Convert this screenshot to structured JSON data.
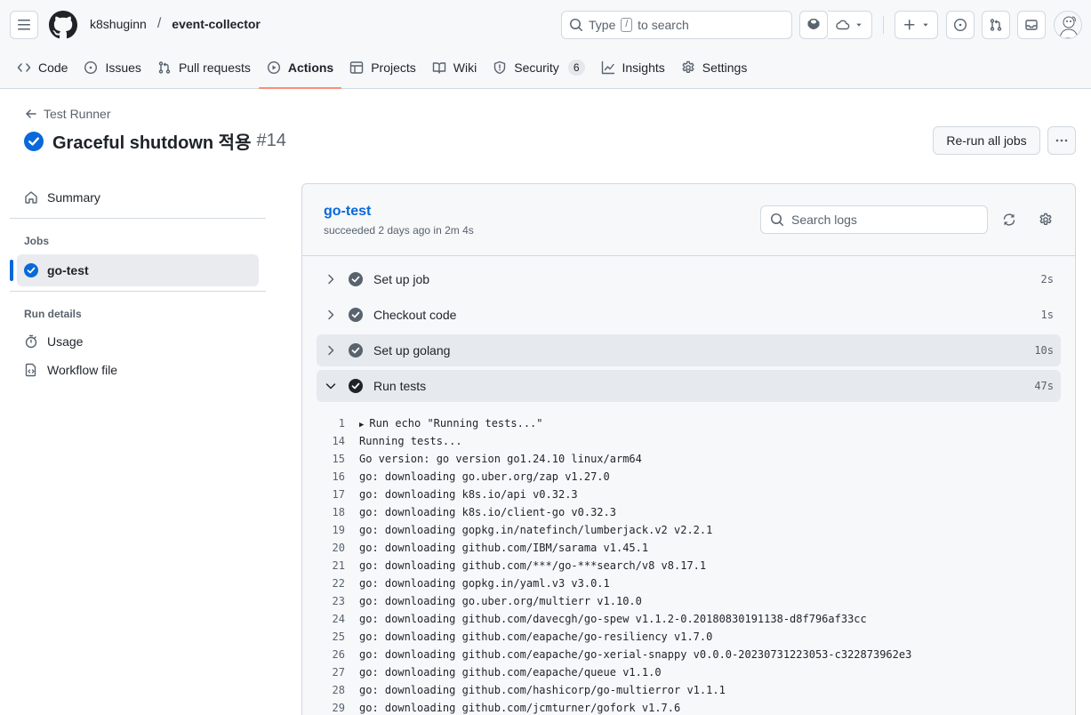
{
  "header": {
    "owner": "k8shuginn",
    "separator": "/",
    "repo": "event-collector",
    "search_prefix": "Type",
    "search_key": "/",
    "search_suffix": "to search"
  },
  "nav": [
    {
      "label": "Code",
      "icon": "code-icon"
    },
    {
      "label": "Issues",
      "icon": "issue-icon"
    },
    {
      "label": "Pull requests",
      "icon": "pull-request-icon"
    },
    {
      "label": "Actions",
      "icon": "play-icon",
      "active": true
    },
    {
      "label": "Projects",
      "icon": "table-icon"
    },
    {
      "label": "Wiki",
      "icon": "book-icon"
    },
    {
      "label": "Security",
      "icon": "shield-icon",
      "counter": "6"
    },
    {
      "label": "Insights",
      "icon": "graph-icon"
    },
    {
      "label": "Settings",
      "icon": "gear-icon"
    }
  ],
  "run": {
    "back_label": "Test Runner",
    "title": "Graceful shutdown 적용",
    "number": "#14",
    "rerun_label": "Re-run all jobs"
  },
  "sidebar": {
    "summary_label": "Summary",
    "jobs_heading": "Jobs",
    "job_label": "go-test",
    "details_heading": "Run details",
    "usage_label": "Usage",
    "workflow_label": "Workflow file"
  },
  "job": {
    "name": "go-test",
    "status": "succeeded 2 days ago in 2m 4s",
    "search_placeholder": "Search logs",
    "steps": [
      {
        "name": "Set up job",
        "duration": "2s",
        "expanded": false
      },
      {
        "name": "Checkout code",
        "duration": "1s",
        "expanded": false
      },
      {
        "name": "Set up golang",
        "duration": "10s",
        "expanded": false
      },
      {
        "name": "Run tests",
        "duration": "47s",
        "expanded": true
      }
    ],
    "log_lines": [
      {
        "n": "1",
        "text": "Run echo \"Running tests...\"",
        "collapsed": true
      },
      {
        "n": "14",
        "text": "Running tests..."
      },
      {
        "n": "15",
        "text": "Go version: go version go1.24.10 linux/arm64"
      },
      {
        "n": "16",
        "text": "go: downloading go.uber.org/zap v1.27.0"
      },
      {
        "n": "17",
        "text": "go: downloading k8s.io/api v0.32.3"
      },
      {
        "n": "18",
        "text": "go: downloading k8s.io/client-go v0.32.3"
      },
      {
        "n": "19",
        "text": "go: downloading gopkg.in/natefinch/lumberjack.v2 v2.2.1"
      },
      {
        "n": "20",
        "text": "go: downloading github.com/IBM/sarama v1.45.1"
      },
      {
        "n": "21",
        "text": "go: downloading github.com/***/go-***search/v8 v8.17.1"
      },
      {
        "n": "22",
        "text": "go: downloading gopkg.in/yaml.v3 v3.0.1"
      },
      {
        "n": "23",
        "text": "go: downloading go.uber.org/multierr v1.10.0"
      },
      {
        "n": "24",
        "text": "go: downloading github.com/davecgh/go-spew v1.1.2-0.20180830191138-d8f796af33cc"
      },
      {
        "n": "25",
        "text": "go: downloading github.com/eapache/go-resiliency v1.7.0"
      },
      {
        "n": "26",
        "text": "go: downloading github.com/eapache/go-xerial-snappy v0.0.0-20230731223053-c322873962e3"
      },
      {
        "n": "27",
        "text": "go: downloading github.com/eapache/queue v1.1.0"
      },
      {
        "n": "28",
        "text": "go: downloading github.com/hashicorp/go-multierror v1.1.1"
      },
      {
        "n": "29",
        "text": "go: downloading github.com/jcmturner/gofork v1.7.6"
      }
    ]
  },
  "colors": {
    "accent": "#0969da",
    "success": "#1a7f37",
    "active_tab_underline": "#fd8c73"
  }
}
